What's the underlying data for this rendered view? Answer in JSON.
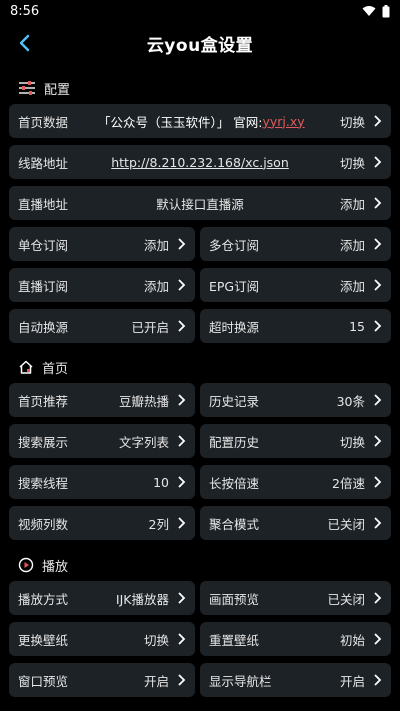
{
  "status_bar": {
    "time": "8:56"
  },
  "header": {
    "title": "云you盒设置"
  },
  "sections": {
    "config": {
      "title": "配置"
    },
    "home": {
      "title": "首页"
    },
    "play": {
      "title": "播放"
    }
  },
  "config_rows": {
    "home_data": {
      "label": "首页数据",
      "value": "「公众号（玉玉软件）」 官网:",
      "site": "yyrj.xy",
      "action": "切换"
    },
    "line_addr": {
      "label": "线路地址",
      "value": "http://8.210.232.168/xc.json",
      "action": "切换"
    },
    "live_addr": {
      "label": "直播地址",
      "value": "默认接口直播源",
      "action": "添加"
    }
  },
  "grid": {
    "single_sub": {
      "label": "单仓订阅",
      "value": "添加"
    },
    "multi_sub": {
      "label": "多仓订阅",
      "value": "添加"
    },
    "live_sub": {
      "label": "直播订阅",
      "value": "添加"
    },
    "epg_sub": {
      "label": "EPG订阅",
      "value": "添加"
    },
    "auto_switch": {
      "label": "自动换源",
      "value": "已开启"
    },
    "timeout_switch": {
      "label": "超时换源",
      "value": "15"
    },
    "home_rec": {
      "label": "首页推荐",
      "value": "豆瓣热播"
    },
    "history": {
      "label": "历史记录",
      "value": "30条"
    },
    "search_display": {
      "label": "搜索展示",
      "value": "文字列表"
    },
    "config_history": {
      "label": "配置历史",
      "value": "切换"
    },
    "search_threads": {
      "label": "搜索线程",
      "value": "10"
    },
    "long_press_speed": {
      "label": "长按倍速",
      "value": "2倍速"
    },
    "video_columns": {
      "label": "视频列数",
      "value": "2列"
    },
    "aggregate_mode": {
      "label": "聚合模式",
      "value": "已关闭"
    },
    "play_method": {
      "label": "播放方式",
      "value": "IJK播放器"
    },
    "screen_preview": {
      "label": "画面预览",
      "value": "已关闭"
    },
    "change_wallpaper": {
      "label": "更换壁纸",
      "value": "切换"
    },
    "reset_wallpaper": {
      "label": "重置壁纸",
      "value": "初始"
    },
    "window_preview": {
      "label": "窗口预览",
      "value": "开启"
    },
    "show_navbar": {
      "label": "显示导航栏",
      "value": "开启"
    }
  },
  "colors": {
    "background": "#000000",
    "row_bg": "#1d2227",
    "link": "#e05a5a",
    "accent_icon": "#4fc3f7"
  }
}
